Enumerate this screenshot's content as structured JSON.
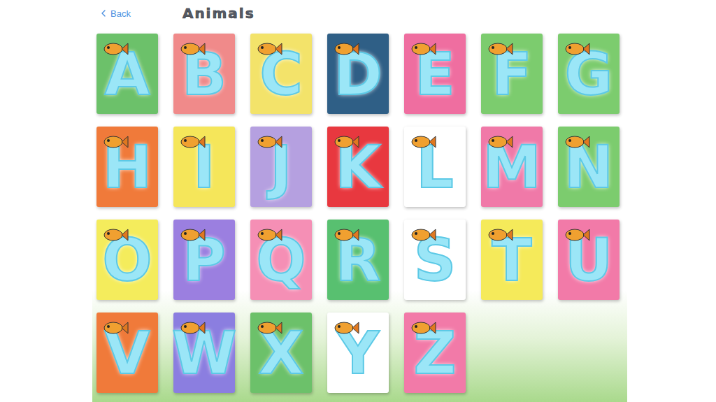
{
  "header": {
    "back": "Back",
    "title": "Animals"
  },
  "cards": [
    {
      "letter": "A",
      "color": "#6cc16a"
    },
    {
      "letter": "B",
      "color": "#f08a8a"
    },
    {
      "letter": "C",
      "color": "#f3e36a"
    },
    {
      "letter": "D",
      "color": "#2f5f86"
    },
    {
      "letter": "E",
      "color": "#ef6ea0"
    },
    {
      "letter": "F",
      "color": "#7ccc6e"
    },
    {
      "letter": "G",
      "color": "#7ccc6e"
    },
    {
      "letter": "H",
      "color": "#f07a3a"
    },
    {
      "letter": "I",
      "color": "#f5e65a"
    },
    {
      "letter": "J",
      "color": "#b5a0e0"
    },
    {
      "letter": "K",
      "color": "#e8383f"
    },
    {
      "letter": "L",
      "color": "#ffffff"
    },
    {
      "letter": "M",
      "color": "#f079a8"
    },
    {
      "letter": "N",
      "color": "#7ccc6e"
    },
    {
      "letter": "O",
      "color": "#f4ec5c"
    },
    {
      "letter": "P",
      "color": "#9b7fe0"
    },
    {
      "letter": "Q",
      "color": "#f58fb5"
    },
    {
      "letter": "R",
      "color": "#58c070"
    },
    {
      "letter": "S",
      "color": "#ffffff"
    },
    {
      "letter": "T",
      "color": "#f5ea5a"
    },
    {
      "letter": "U",
      "color": "#f27aa8"
    },
    {
      "letter": "V",
      "color": "#f07a3a"
    },
    {
      "letter": "W",
      "color": "#8b7ee0"
    },
    {
      "letter": "X",
      "color": "#6cc16a"
    },
    {
      "letter": "Y",
      "color": "#ffffff"
    },
    {
      "letter": "Z",
      "color": "#f27aa8"
    }
  ]
}
